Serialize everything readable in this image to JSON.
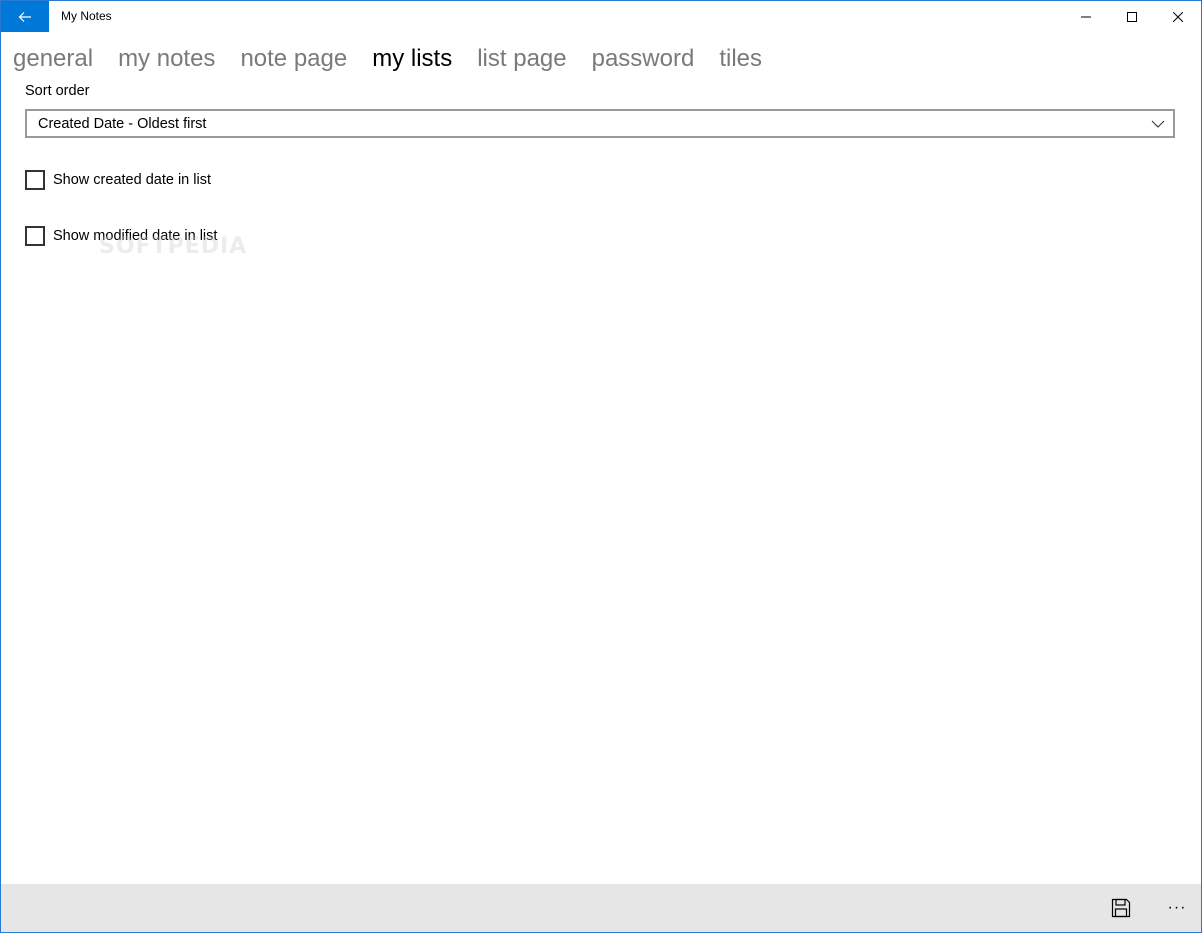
{
  "window": {
    "title": "My Notes",
    "accent_color": "#0078d7"
  },
  "titlebar": {
    "back_icon": "arrow-left-icon",
    "minimize_icon": "minimize-icon",
    "maximize_icon": "maximize-icon",
    "close_icon": "close-icon"
  },
  "pivot": {
    "tabs": [
      {
        "label": "general",
        "active": false
      },
      {
        "label": "my notes",
        "active": false
      },
      {
        "label": "note page",
        "active": false
      },
      {
        "label": "my lists",
        "active": true
      },
      {
        "label": "list page",
        "active": false
      },
      {
        "label": "password",
        "active": false
      },
      {
        "label": "tiles",
        "active": false
      }
    ]
  },
  "settings": {
    "sort_order_label": "Sort order",
    "sort_order_value": "Created Date - Oldest first",
    "checkboxes": [
      {
        "label": "Show created date in list",
        "checked": false
      },
      {
        "label": "Show modified date in list",
        "checked": false
      }
    ]
  },
  "watermark": {
    "text": "SOFTPEDIA"
  },
  "command_bar": {
    "save_icon": "save-icon",
    "more_label": "···"
  }
}
